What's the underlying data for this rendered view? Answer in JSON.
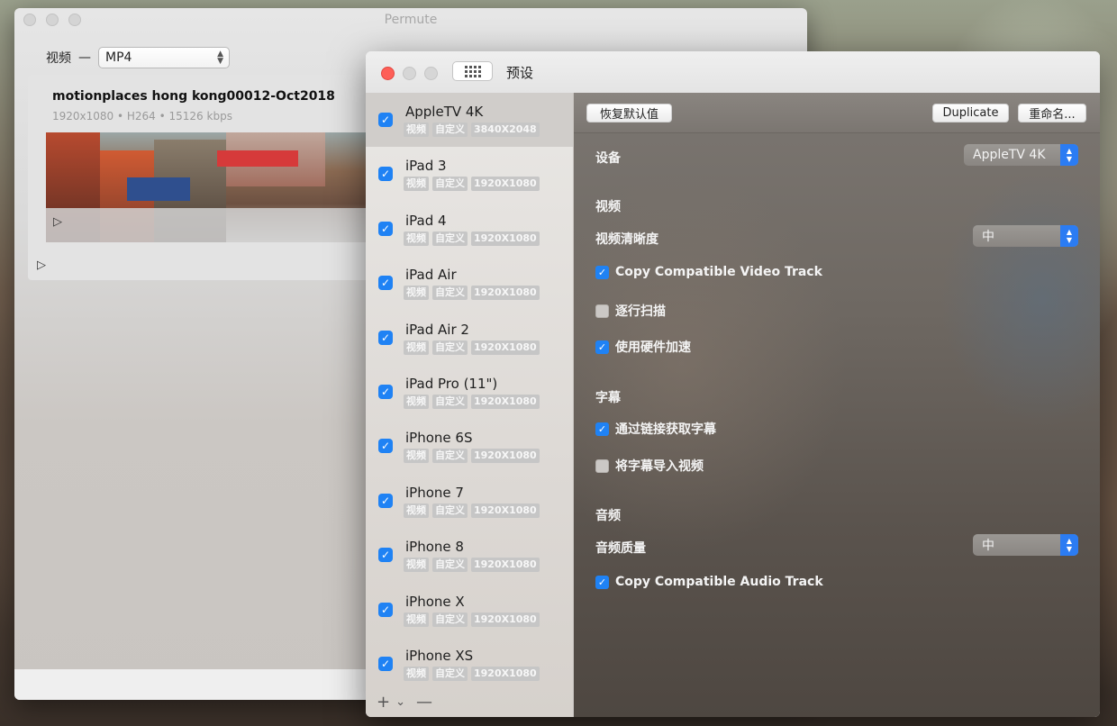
{
  "main_window": {
    "title": "Permute",
    "format_label": "视频",
    "format_dash": "—",
    "format_value": "MP4",
    "file": {
      "name": "motionplaces hong kong00012-Oct2018",
      "meta": "1920x1080 • H264 • 15126 kbps"
    },
    "play_glyph": "▷"
  },
  "preset_window": {
    "title": "预设",
    "sidebar_items": [
      {
        "name": "AppleTV 4K",
        "tags": [
          "视频",
          "自定义",
          "3840X2048"
        ],
        "checked": true,
        "selected": true
      },
      {
        "name": "iPad 3",
        "tags": [
          "视频",
          "自定义",
          "1920X1080"
        ],
        "checked": true
      },
      {
        "name": "iPad 4",
        "tags": [
          "视频",
          "自定义",
          "1920X1080"
        ],
        "checked": true
      },
      {
        "name": "iPad Air",
        "tags": [
          "视频",
          "自定义",
          "1920X1080"
        ],
        "checked": true
      },
      {
        "name": "iPad Air 2",
        "tags": [
          "视频",
          "自定义",
          "1920X1080"
        ],
        "checked": true
      },
      {
        "name": "iPad Pro (11\")",
        "tags": [
          "视频",
          "自定义",
          "1920X1080"
        ],
        "checked": true
      },
      {
        "name": "iPhone 6S",
        "tags": [
          "视频",
          "自定义",
          "1920X1080"
        ],
        "checked": true
      },
      {
        "name": "iPhone 7",
        "tags": [
          "视频",
          "自定义",
          "1920X1080"
        ],
        "checked": true
      },
      {
        "name": "iPhone 8",
        "tags": [
          "视频",
          "自定义",
          "1920X1080"
        ],
        "checked": true
      },
      {
        "name": "iPhone X",
        "tags": [
          "视频",
          "自定义",
          "1920X1080"
        ],
        "checked": true
      },
      {
        "name": "iPhone XS",
        "tags": [
          "视频",
          "自定义",
          "1920X1080"
        ],
        "checked": true
      }
    ],
    "sidebar_footer": {
      "add": "+",
      "chevron": "⌄",
      "remove": "—"
    },
    "toolbar": {
      "restore_label": "恢复默认值",
      "duplicate_label": "Duplicate",
      "rename_label": "重命名..."
    },
    "settings": {
      "device_label": "设备",
      "device_value": "AppleTV 4K",
      "video_section": "视频",
      "video_quality_label": "视频清晰度",
      "video_quality_value": "中",
      "copy_video_label": "Copy Compatible Video Track",
      "copy_video_checked": true,
      "progressive_label": "逐行扫描",
      "progressive_checked": false,
      "hw_accel_label": "使用硬件加速",
      "hw_accel_checked": true,
      "subtitles_section": "字幕",
      "fetch_subs_label": "通过链接获取字幕",
      "fetch_subs_checked": true,
      "import_subs_label": "将字幕导入视频",
      "import_subs_checked": false,
      "audio_section": "音频",
      "audio_quality_label": "音频质量",
      "audio_quality_value": "中",
      "copy_audio_label": "Copy Compatible Audio Track",
      "copy_audio_checked": true
    }
  },
  "colors": {
    "accent": "#1f82f4",
    "close": "#fe5f57"
  }
}
